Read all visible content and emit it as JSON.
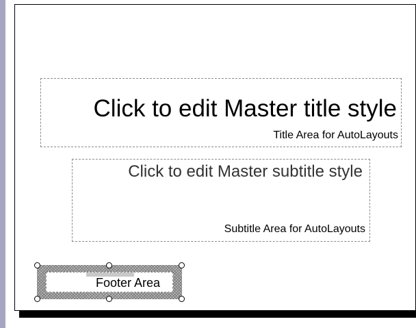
{
  "slide_master": {
    "title_placeholder": {
      "text": "Click to edit Master title style",
      "caption": "Title Area for AutoLayouts"
    },
    "subtitle_placeholder": {
      "text": "Click to edit Master subtitle style",
      "caption": "Subtitle Area for AutoLayouts"
    },
    "footer_placeholder": {
      "caption": "Footer Area",
      "selected": true
    }
  },
  "colors": {
    "workspace": "#a6a6c3",
    "slide_background": "#ffffff",
    "shadow": "#000000",
    "placeholder_border": "#8a8a8a"
  }
}
